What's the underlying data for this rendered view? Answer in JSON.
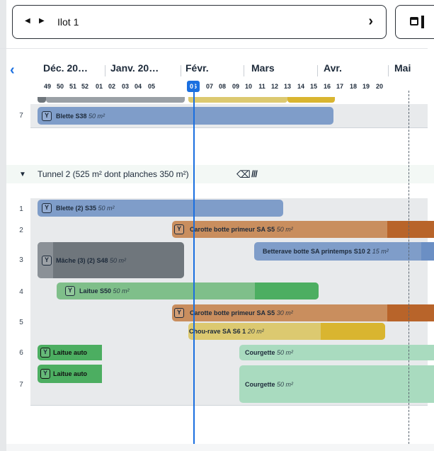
{
  "selector": {
    "prev_icon": "triangle-left-icon",
    "next_icon": "triangle-right-icon",
    "label": "Ilot 1",
    "chevron": "›"
  },
  "months": [
    "Déc. 20…",
    "Janv. 20…",
    "Févr.",
    "Mars",
    "Avr.",
    "Mai"
  ],
  "weeks": [
    "49",
    "50",
    "51",
    "52",
    "01",
    "02",
    "03",
    "04",
    "05",
    "06",
    "07",
    "08",
    "09",
    "10",
    "11",
    "12",
    "13",
    "14",
    "15",
    "16",
    "17",
    "18",
    "19",
    "20"
  ],
  "current_week": "06",
  "top_row": {
    "number": "7",
    "crop": "Blette S38",
    "area": "50 m²"
  },
  "section": {
    "title": "Tunnel 2 (525 m² dont planches 350 m²)",
    "icons": [
      "eraser-icon",
      "stripes-icon"
    ]
  },
  "rows": [
    {
      "number": "1",
      "bars": [
        {
          "crop": "Blette (2) S35",
          "area": "50 m²"
        }
      ]
    },
    {
      "number": "2",
      "bars": [
        {
          "crop": "Carotte botte primeur SA S5",
          "area": "50 m²"
        }
      ]
    },
    {
      "number": "3",
      "bars": [
        {
          "crop": "Mâche (3) (2) S48",
          "area": "50 m²"
        },
        {
          "crop": "Betterave botte SA printemps S10 2",
          "area": "15 m²"
        }
      ]
    },
    {
      "number": "4",
      "bars": [
        {
          "crop": "Laitue S50",
          "area": "50 m²"
        }
      ]
    },
    {
      "number": "5",
      "bars": [
        {
          "crop": "Carotte botte primeur SA S5",
          "area": "30 m²"
        },
        {
          "crop": "Chou-rave SA S6 1",
          "area": "20 m²"
        }
      ]
    },
    {
      "number": "6",
      "bars": [
        {
          "crop": "Laitue auto",
          "area": ""
        },
        {
          "crop": "Courgette",
          "area": "50 m²"
        }
      ]
    },
    {
      "number": "7",
      "bars": [
        {
          "crop": "Laitue auto",
          "area": ""
        },
        {
          "crop": "Courgette",
          "area": "50 m²"
        }
      ]
    }
  ],
  "colors": {
    "accent": "#1a6fe0",
    "blue_bar": "#7f9dc9",
    "orange_bar": "#c98e5e",
    "green_bar": "#7fbf8a",
    "yellow_bar": "#dcc970",
    "grey_bar": "#6f767c",
    "light_green_bar": "#a9dbbf"
  }
}
